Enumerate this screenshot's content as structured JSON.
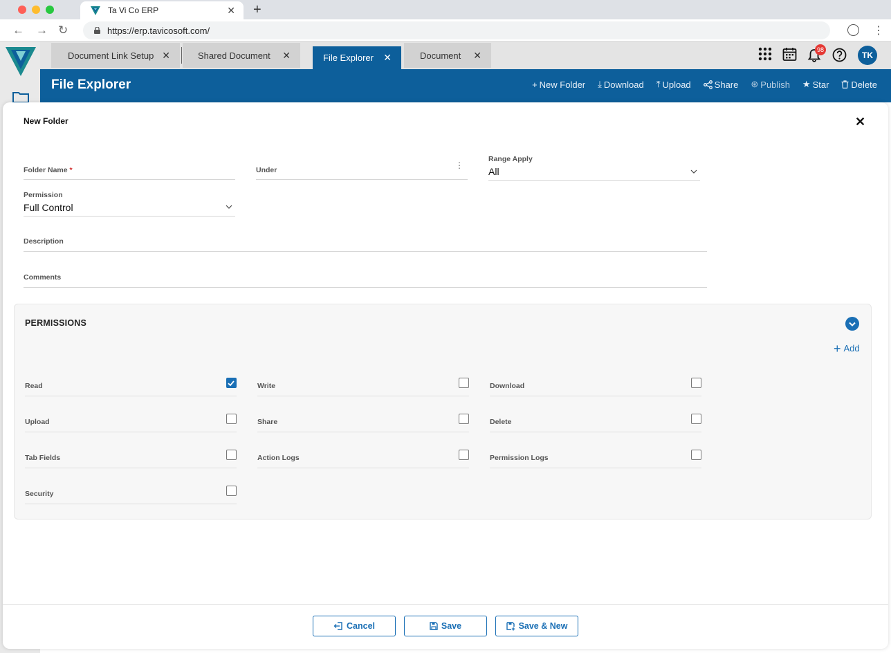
{
  "browser": {
    "tab_title": "Ta Vi Co ERP",
    "url": "https://erp.tavicosoft.com/"
  },
  "app": {
    "tabs": [
      {
        "label": "Document Link Setup",
        "active": false
      },
      {
        "label": "Shared Document",
        "active": false
      },
      {
        "label": "File Explorer",
        "active": true
      },
      {
        "label": "Document",
        "active": false
      }
    ],
    "notification_count": "98",
    "user_initials": "TK",
    "page_title": "File Explorer",
    "actions": [
      {
        "label": "New Folder",
        "icon": "plus-icon"
      },
      {
        "label": "Download",
        "icon": "download-icon"
      },
      {
        "label": "Upload",
        "icon": "upload-icon"
      },
      {
        "label": "Share",
        "icon": "share-icon"
      },
      {
        "label": "Publish",
        "icon": "publish-icon"
      },
      {
        "label": "Star",
        "icon": "star-icon"
      },
      {
        "label": "Delete",
        "icon": "trash-icon"
      }
    ]
  },
  "modal": {
    "title": "New Folder",
    "fields": {
      "folder_name": {
        "label": "Folder Name",
        "required_mark": "*",
        "value": ""
      },
      "under": {
        "label": "Under",
        "value": ""
      },
      "range_apply": {
        "label": "Range Apply",
        "value": "All"
      },
      "permission": {
        "label": "Permission",
        "value": "Full Control"
      },
      "description": {
        "label": "Description",
        "value": ""
      },
      "comments": {
        "label": "Comments",
        "value": ""
      }
    },
    "permissions": {
      "title": "PERMISSIONS",
      "add_label": "Add",
      "items": [
        {
          "label": "Read",
          "checked": true
        },
        {
          "label": "Write",
          "checked": false
        },
        {
          "label": "Download",
          "checked": false
        },
        {
          "label": "Upload",
          "checked": false
        },
        {
          "label": "Share",
          "checked": false
        },
        {
          "label": "Delete",
          "checked": false
        },
        {
          "label": "Tab Fields",
          "checked": false
        },
        {
          "label": "Action Logs",
          "checked": false
        },
        {
          "label": "Permission Logs",
          "checked": false
        },
        {
          "label": "Security",
          "checked": false
        }
      ]
    },
    "footer": {
      "cancel_label": "Cancel",
      "save_label": "Save",
      "save_new_label": "Save & New"
    }
  },
  "colors": {
    "primary": "#0d5f9b",
    "accent": "#1a6fb5",
    "required": "#d32f2f",
    "badge": "#e53935"
  }
}
